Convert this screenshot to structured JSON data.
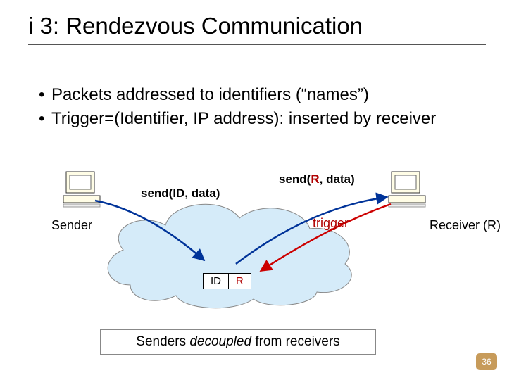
{
  "title": "i 3: Rendezvous Communication",
  "bullets": [
    "Packets addressed to identifiers (“names”)",
    "Trigger=(Identifier, IP address): inserted by receiver"
  ],
  "labels": {
    "send_id": "send(ID, data)",
    "send_r_prefix": "send(",
    "send_r_r": "R",
    "send_r_suffix": ", data)",
    "sender": "Sender",
    "receiver": "Receiver (R)",
    "trigger": "trigger",
    "box_id": "ID",
    "box_r": "R"
  },
  "caption": {
    "a": "Senders ",
    "b": "decoupled",
    "c": " from receivers"
  },
  "page": "36"
}
